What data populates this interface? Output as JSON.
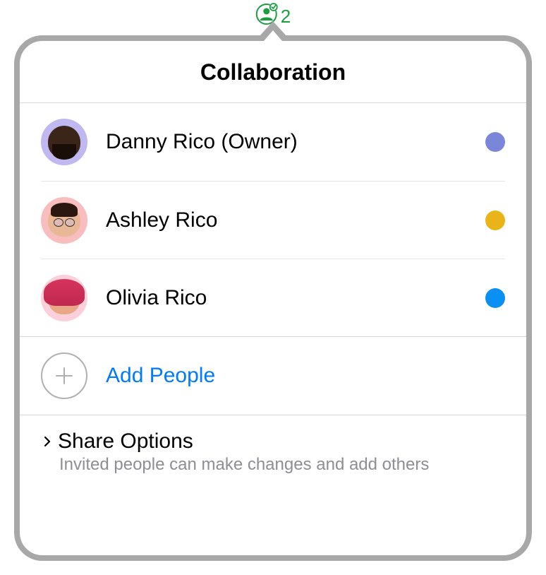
{
  "indicator": {
    "count": "2"
  },
  "popover": {
    "title": "Collaboration",
    "participants": [
      {
        "name": "Danny Rico (Owner)",
        "dotColor": "#7a87d8"
      },
      {
        "name": "Ashley Rico",
        "dotColor": "#e8b417"
      },
      {
        "name": "Olivia Rico",
        "dotColor": "#0a8ff2"
      }
    ],
    "addPeople": "Add People",
    "shareOptions": {
      "title": "Share Options",
      "subtitle": "Invited people can make changes and add others"
    }
  }
}
